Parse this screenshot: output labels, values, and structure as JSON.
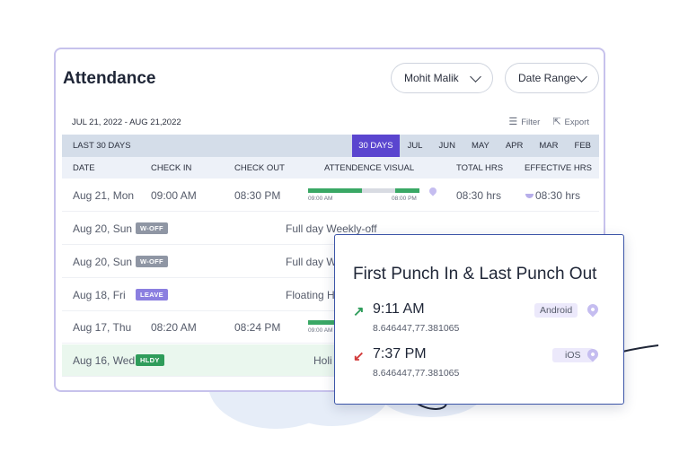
{
  "colors": {
    "accent": "#5a45cf",
    "green": "#2e9c5a",
    "red_arrow": "#d23b3b",
    "green_arrow": "#2e9c5a"
  },
  "header": {
    "title": "Attendance",
    "user_select": "Mohit Malik",
    "date_range_select": "Date Range"
  },
  "toolbar": {
    "date_range_text": "JUL 21, 2022 - AUG 21,2022",
    "filter_label": "Filter",
    "export_label": "Export"
  },
  "range_bar": {
    "label": "LAST 30 DAYS",
    "tabs": [
      "30 DAYS",
      "JUL",
      "JUN",
      "MAY",
      "APR",
      "MAR",
      "FEB"
    ],
    "active_tab": "30 DAYS"
  },
  "columns": [
    "DATE",
    "CHECK IN",
    "CHECK OUT",
    "ATTENDENCE VISUAL",
    "TOTAL HRS",
    "EFFECTIVE HRS"
  ],
  "rows": [
    {
      "date": "Aug 21, Mon",
      "check_in": "09:00 AM",
      "check_out": "08:30 PM",
      "visual_start": "09:00 AM",
      "visual_end": "08:00 PM",
      "total": "08:30 hrs",
      "effective": "08:30 hrs"
    },
    {
      "date": "Aug 20, Sun",
      "badge": "W-OFF",
      "note": "Full day Weekly-off"
    },
    {
      "date": "Aug 20, Sun",
      "badge": "W-OFF",
      "note": "Full day We"
    },
    {
      "date": "Aug 18, Fri",
      "badge": "LEAVE",
      "note": "Floating Ho"
    },
    {
      "date": "Aug 17, Thu",
      "check_in": "08:20 AM",
      "check_out": "08:24 PM",
      "visual_start": "09:00 AM"
    },
    {
      "date": "Aug 16, Wed",
      "badge": "HLDY",
      "note": "Holi"
    }
  ],
  "popup": {
    "title": "First Punch In & Last Punch Out",
    "entries": [
      {
        "time": "9:11 AM",
        "coords": "8.646447,77.381065",
        "device": "Android",
        "arrow_icon": "arrow-up-right-icon"
      },
      {
        "time": "7:37 PM",
        "coords": "8.646447,77.381065",
        "device": "iOS",
        "arrow_icon": "arrow-down-left-icon"
      }
    ]
  }
}
